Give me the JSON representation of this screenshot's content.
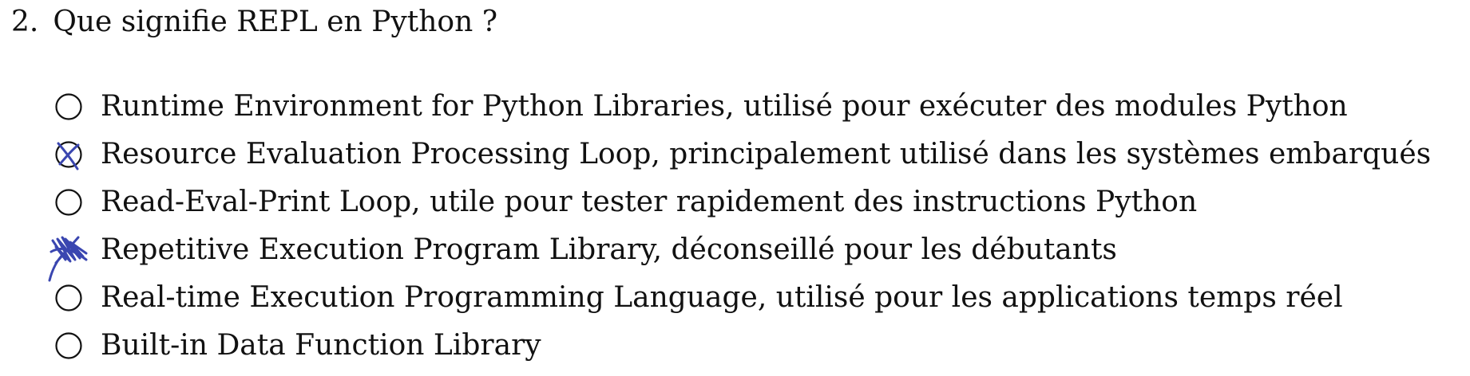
{
  "question": {
    "number": "2.",
    "text": "Que signifie REPL en Python ?"
  },
  "options": [
    {
      "label": "Runtime Environment for Python Libraries, utilisé pour exécuter des modules Python",
      "mark": "none"
    },
    {
      "label": "Resource Evaluation Processing Loop, principalement utilisé dans les systèmes embarqués",
      "mark": "crossed"
    },
    {
      "label": "Read-Eval-Print Loop, utile pour tester rapidement des instructions Python",
      "mark": "none"
    },
    {
      "label": "Repetitive Execution Program Library, déconseillé pour les débutants",
      "mark": "scribbled"
    },
    {
      "label": "Real-time Execution Programming Language, utilisé pour les applications temps réel",
      "mark": "none"
    },
    {
      "label": "Built-in Data Function Library",
      "mark": "none"
    }
  ],
  "colors": {
    "ink": "#111111",
    "pen": "#3a46b0"
  }
}
